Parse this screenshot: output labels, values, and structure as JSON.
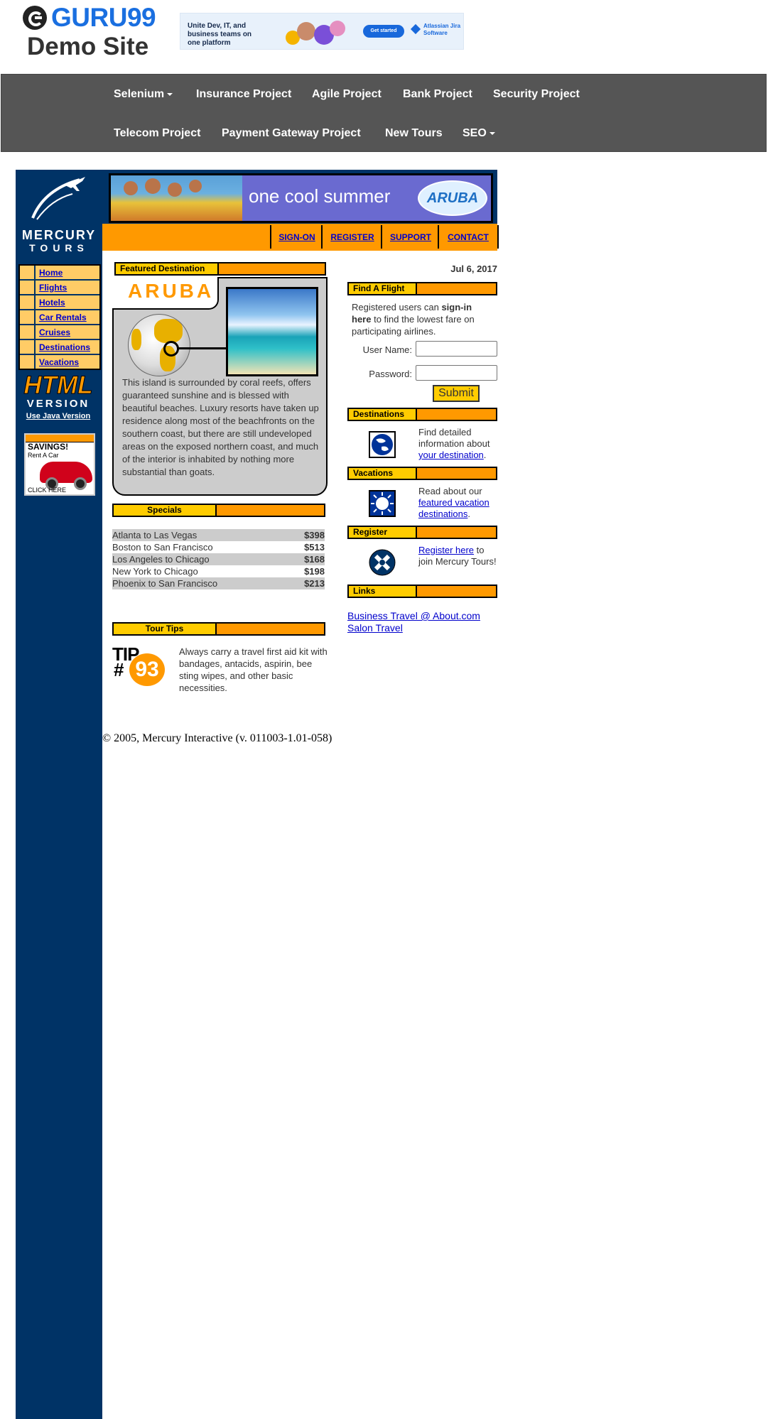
{
  "site": {
    "logo_text": "GURU99",
    "logo_subtitle": "Demo Site"
  },
  "ad": {
    "headline": "Unite Dev, IT, and business teams on one platform",
    "button": "Get started",
    "brand": "Atlassian Jira Software"
  },
  "nav": {
    "items": [
      {
        "label": "Selenium",
        "dropdown": true
      },
      {
        "label": "Insurance Project"
      },
      {
        "label": "Agile Project"
      },
      {
        "label": "Bank Project"
      },
      {
        "label": "Security Project"
      },
      {
        "label": "Telecom Project"
      },
      {
        "label": "Payment Gateway Project"
      },
      {
        "label": "New Tours"
      },
      {
        "label": "SEO",
        "dropdown": true
      }
    ]
  },
  "mercury": {
    "brand_name": "MERCURY",
    "brand_sub": "TOURS",
    "sidebar_menu": [
      "Home",
      "Flights",
      "Hotels",
      "Car Rentals",
      "Cruises",
      "Destinations",
      "Vacations"
    ],
    "html_version": {
      "big": "HTML",
      "small": "VERSION",
      "link": "Use Java Version"
    },
    "savings_ad": {
      "title": "SAVINGS!",
      "subtitle": "Rent A Car",
      "cta": "CLICK HERE"
    },
    "banner": {
      "text": "one cool summer",
      "badge": "ARUBA"
    },
    "top_links": [
      "SIGN-ON",
      "REGISTER",
      "SUPPORT",
      "CONTACT"
    ],
    "date": "Jul 6, 2017",
    "featured": {
      "header": "Featured Destination",
      "name": "ARUBA",
      "description": "This island is surrounded by coral reefs, offers guaranteed sunshine and is blessed with beautiful beaches. Luxury resorts have taken up residence along most of the beachfronts on the southern coast, but there are still undeveloped areas on the exposed northern coast, and much of the interior is inhabited by nothing more substantial than goats."
    },
    "specials": {
      "header": "Specials",
      "rows": [
        {
          "route": "Atlanta to Las Vegas",
          "price": "$398"
        },
        {
          "route": "Boston to San Francisco",
          "price": "$513"
        },
        {
          "route": "Los Angeles to Chicago",
          "price": "$168"
        },
        {
          "route": "New York to Chicago",
          "price": "$198"
        },
        {
          "route": "Phoenix to San Francisco",
          "price": "$213"
        }
      ]
    },
    "tour_tips": {
      "header": "Tour Tips",
      "logo_word": "TIP",
      "logo_hash": "#",
      "logo_number": "93",
      "text": "Always carry a travel first aid kit with bandages, antacids, aspirin, bee sting wipes, and other basic necessities."
    },
    "find_flight": {
      "header": "Find A Flight",
      "intro_pre": "Registered users can ",
      "intro_bold": "sign-in here",
      "intro_post": " to find the lowest fare on participating airlines.",
      "username_label": "User Name:",
      "password_label": "Password:",
      "username_value": "",
      "password_value": "",
      "submit": "Submit"
    },
    "destinations": {
      "header": "Destinations",
      "pre": "Find detailed information about ",
      "link": "your destination",
      "post": "."
    },
    "vacations": {
      "header": "Vacations",
      "pre": "Read about our ",
      "link": "featured vacation destinations",
      "post": "."
    },
    "register": {
      "header": "Register",
      "link": "Register here",
      "post": " to join Mercury Tours!"
    },
    "links": {
      "header": "Links",
      "items": [
        "Business Travel @ About.com",
        "Salon Travel"
      ]
    },
    "copyright": "© 2005, Mercury Interactive (v. 011003-1.01-058)"
  }
}
